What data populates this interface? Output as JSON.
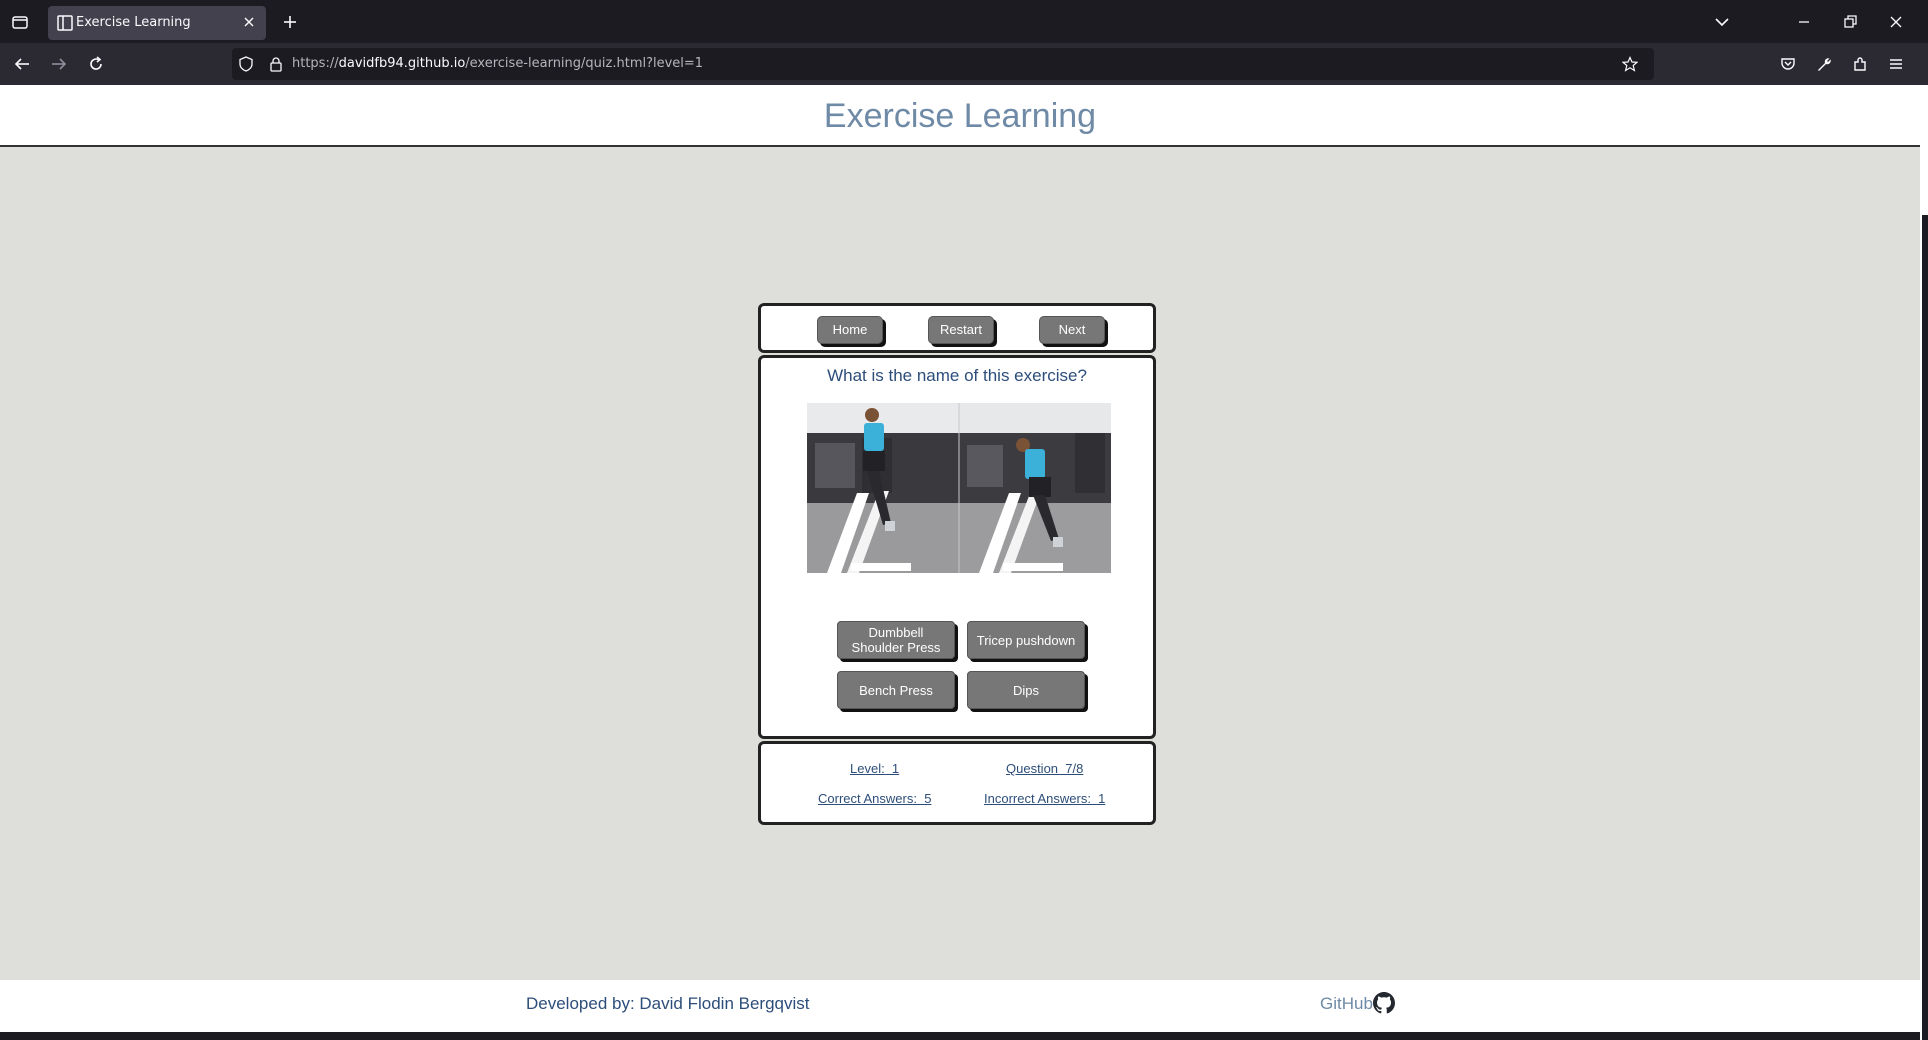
{
  "browser": {
    "tab_title": "Exercise Learning",
    "url_scheme": "https://",
    "url_host": "davidfb94.github.io",
    "url_path": "/exercise-learning/quiz.html?level=1"
  },
  "site": {
    "title": "Exercise Learning"
  },
  "nav_buttons": {
    "home": "Home",
    "restart": "Restart",
    "next": "Next"
  },
  "quiz": {
    "question": "What is the name of this exercise?",
    "image_icon": "exercise-photo-dips",
    "answers": [
      "Dumbbell Shoulder Press",
      "Tricep pushdown",
      "Bench Press",
      "Dips"
    ]
  },
  "stats": {
    "level": "Level:  1",
    "question": "Question  7/8",
    "correct": "Correct Answers:  5",
    "incorrect": "Incorrect Answers:  1"
  },
  "footer": {
    "developer": "Developed by: David Flodin Bergqvist",
    "github": "GitHub"
  },
  "colors": {
    "page_bg": "#dededa",
    "title": "#6f8aa6",
    "text_blue": "#2d4e7a",
    "button_gray": "#777777"
  }
}
